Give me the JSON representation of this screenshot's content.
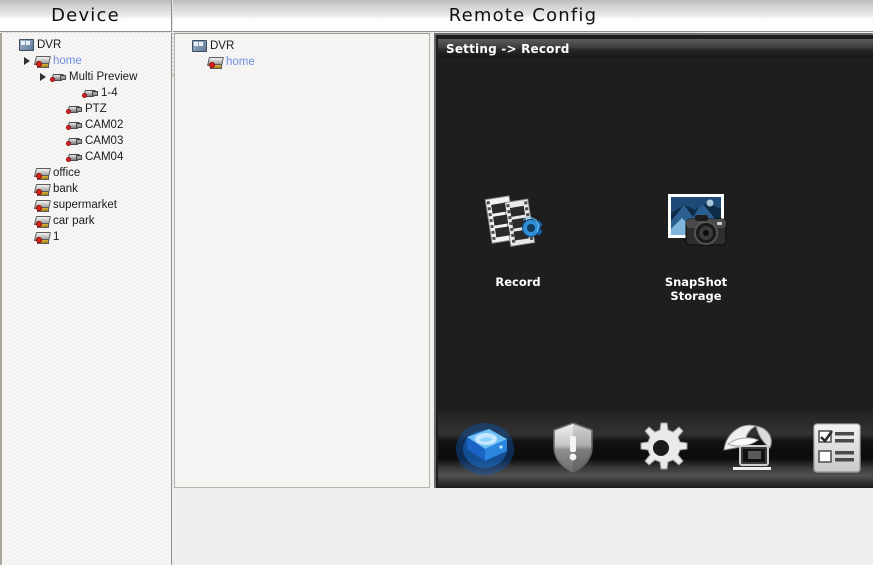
{
  "window": {
    "device_panel_title": "Device",
    "remote_panel_title": "Remote Config"
  },
  "device_tree": {
    "items": [
      {
        "label": "DVR",
        "depth": 0,
        "icon": "dvr-root-icon",
        "twisty": "none",
        "selected": false
      },
      {
        "label": "home",
        "depth": 1,
        "icon": "dvr-device-icon",
        "twisty": "open",
        "selected": true
      },
      {
        "label": "Multi Preview",
        "depth": 2,
        "icon": "camera-icon",
        "twisty": "closed",
        "selected": false
      },
      {
        "label": "1-4",
        "depth": 4,
        "icon": "camera-icon",
        "twisty": "none",
        "selected": false
      },
      {
        "label": "PTZ",
        "depth": 3,
        "icon": "camera-icon",
        "twisty": "none",
        "selected": false
      },
      {
        "label": "CAM02",
        "depth": 3,
        "icon": "camera-icon",
        "twisty": "none",
        "selected": false
      },
      {
        "label": "CAM03",
        "depth": 3,
        "icon": "camera-icon",
        "twisty": "none",
        "selected": false
      },
      {
        "label": "CAM04",
        "depth": 3,
        "icon": "camera-icon",
        "twisty": "none",
        "selected": false
      },
      {
        "label": "office",
        "depth": 1,
        "icon": "dvr-device-icon",
        "twisty": "none",
        "selected": false
      },
      {
        "label": "bank",
        "depth": 1,
        "icon": "dvr-device-icon",
        "twisty": "none",
        "selected": false
      },
      {
        "label": "supermarket",
        "depth": 1,
        "icon": "dvr-device-icon",
        "twisty": "none",
        "selected": false
      },
      {
        "label": "car park",
        "depth": 1,
        "icon": "dvr-device-icon",
        "twisty": "none",
        "selected": false
      },
      {
        "label": "1",
        "depth": 1,
        "icon": "dvr-device-icon",
        "twisty": "none",
        "selected": false
      }
    ]
  },
  "config_tree": {
    "items": [
      {
        "label": "DVR",
        "depth": 0,
        "icon": "dvr-root-icon",
        "twisty": "none",
        "selected": false
      },
      {
        "label": "home",
        "depth": 1,
        "icon": "dvr-device-icon",
        "twisty": "none",
        "selected": true
      }
    ]
  },
  "remote_config": {
    "breadcrumb": "Setting -> Record",
    "icons": [
      {
        "label": "Record",
        "icon": "record-filmstrip-gear-icon"
      },
      {
        "label": "SnapShot Storage",
        "icon": "snapshot-camera-photo-icon"
      }
    ],
    "toolbar": [
      {
        "name": "storage-disk-icon",
        "active": true
      },
      {
        "name": "alarm-shield-icon",
        "active": false
      },
      {
        "name": "system-gear-icon",
        "active": false
      },
      {
        "name": "network-monitor-icon",
        "active": false
      },
      {
        "name": "checklist-info-icon",
        "active": false
      }
    ]
  },
  "colors": {
    "selected_text": "#6e8fe0",
    "panel_bg": "#f1f0ee",
    "dark_bg": "#1d1d1d",
    "accent_blue": "#2d9bf0"
  }
}
